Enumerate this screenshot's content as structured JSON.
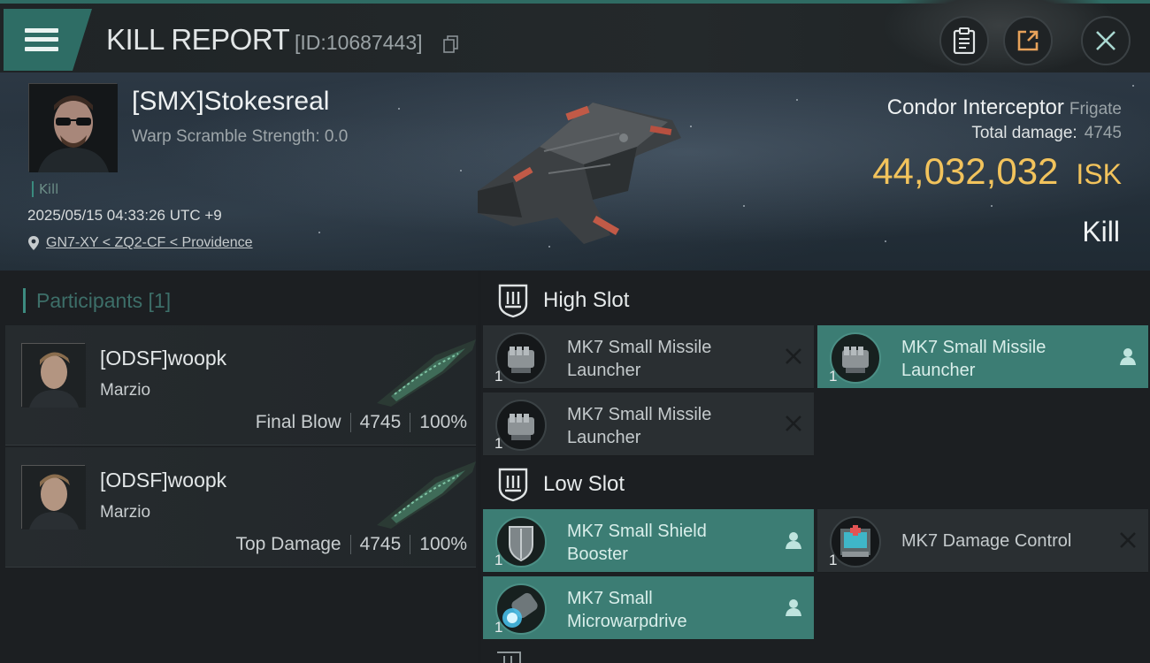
{
  "header": {
    "title": "KILL REPORT",
    "report_id": "[ID:10687443]"
  },
  "victim": {
    "name": "[SMX]Stokesreal",
    "warp_scramble": "Warp Scramble Strength: 0.0",
    "tag": "Kill",
    "datetime": "2025/05/15 04:33:26 UTC +9",
    "location": "GN7-XY < ZQ2-CF < Providence"
  },
  "ship": {
    "name": "Condor Interceptor",
    "class": "Frigate",
    "total_damage_label": "Total damage:",
    "total_damage_value": "4745",
    "isk_amount": "44,032,032",
    "isk_unit": "ISK",
    "result": "Kill"
  },
  "participants": {
    "header": "Participants [1]",
    "rows": [
      {
        "name": "[ODSF]woopk",
        "ship": "Marzio",
        "role": "Final Blow",
        "damage": "4745",
        "percent": "100%"
      },
      {
        "name": "[ODSF]woopk",
        "ship": "Marzio",
        "role": "Top Damage",
        "damage": "4745",
        "percent": "100%"
      }
    ]
  },
  "fitting": {
    "high_slot_title": "High Slot",
    "low_slot_title": "Low Slot",
    "high_modules": [
      {
        "name_line1": "MK7 Small Missile",
        "name_line2": "Launcher",
        "qty": "1",
        "state": "destroyed"
      },
      {
        "name_line1": "MK7 Small Missile",
        "name_line2": "Launcher",
        "qty": "1",
        "state": "dropped"
      },
      {
        "name_line1": "MK7 Small Missile",
        "name_line2": "Launcher",
        "qty": "1",
        "state": "destroyed"
      }
    ],
    "low_modules": [
      {
        "name_line1": "MK7 Small Shield",
        "name_line2": "Booster",
        "qty": "1",
        "state": "dropped"
      },
      {
        "name_line1": "MK7 Damage Control",
        "name_line2": "",
        "qty": "1",
        "state": "destroyed"
      },
      {
        "name_line1": "MK7 Small",
        "name_line2": "Microwarpdrive",
        "qty": "1",
        "state": "dropped"
      }
    ]
  },
  "colors": {
    "accent": "#3c7d74",
    "isk": "#f2c35c"
  }
}
